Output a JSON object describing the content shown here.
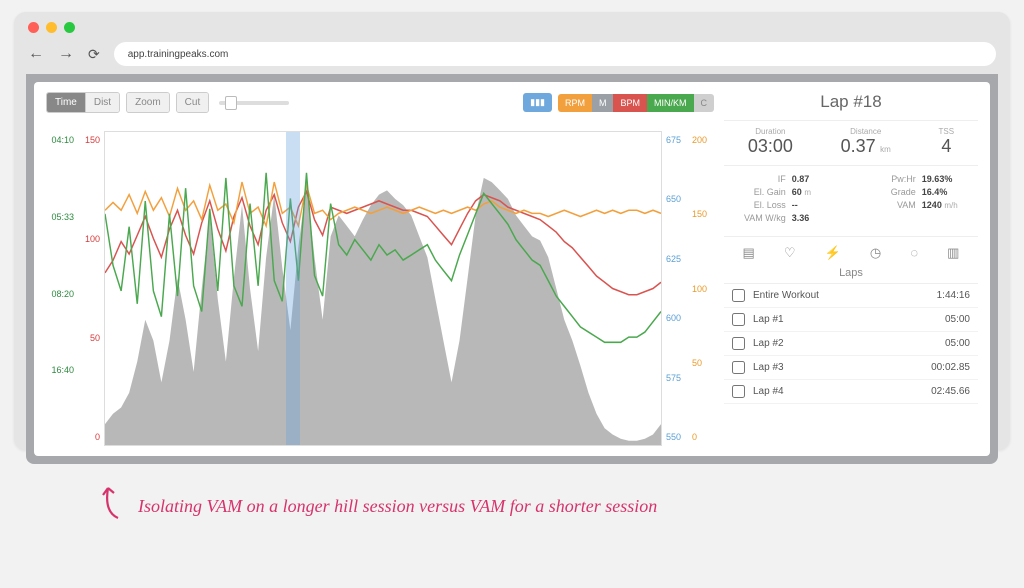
{
  "browser": {
    "url": "app.trainingpeaks.com"
  },
  "toolbar": {
    "time": "Time",
    "dist": "Dist",
    "zoom": "Zoom",
    "cut": "Cut"
  },
  "metrics": {
    "chart_icon": "▮▮▮",
    "rpm": {
      "label": "RPM",
      "color": "#f2a03d"
    },
    "m": {
      "label": "M",
      "color": "#9aa0a6"
    },
    "bpm": {
      "label": "BPM",
      "color": "#d9534f"
    },
    "minkm": {
      "label": "MIN/KM",
      "color": "#4aa84e"
    },
    "c": {
      "label": "C",
      "color": "#cfcfcf"
    }
  },
  "axes": {
    "left1": [
      "04:10",
      "05:33",
      "08:20",
      "16:40",
      ""
    ],
    "left2": [
      "150",
      "100",
      "50",
      "0"
    ],
    "right1": [
      "675",
      "650",
      "625",
      "600",
      "575",
      "550"
    ],
    "right2": [
      "200",
      "150",
      "100",
      "50",
      "0"
    ]
  },
  "chart_data": {
    "type": "line",
    "title": "",
    "xlabel": "",
    "ylabel": "",
    "selection_pct": [
      32.5,
      35.0
    ],
    "series": [
      {
        "name": "Elevation (M)",
        "color": "#a8a8a8",
        "unit": "m",
        "ylim": [
          550,
          700
        ],
        "values": [
          560,
          565,
          568,
          575,
          590,
          610,
          600,
          580,
          600,
          630,
          610,
          585,
          625,
          660,
          620,
          590,
          630,
          665,
          625,
          595,
          640,
          670,
          635,
          605,
          645,
          675,
          640,
          610,
          650,
          660,
          655,
          650,
          658,
          665,
          670,
          672,
          668,
          665,
          660,
          650,
          640,
          620,
          600,
          580,
          600,
          630,
          660,
          678,
          676,
          672,
          668,
          660,
          655,
          650,
          648,
          640,
          625,
          610,
          600,
          588,
          575,
          565,
          558,
          555,
          553,
          552,
          552,
          553,
          555,
          560
        ]
      },
      {
        "name": "BPM",
        "color": "#d9534f",
        "unit": "bpm",
        "ylim": [
          0,
          200
        ],
        "values": [
          110,
          118,
          130,
          122,
          134,
          146,
          132,
          120,
          138,
          150,
          134,
          122,
          142,
          156,
          138,
          124,
          146,
          158,
          140,
          128,
          150,
          160,
          142,
          130,
          152,
          162,
          144,
          134,
          152,
          150,
          148,
          150,
          152,
          154,
          156,
          154,
          152,
          150,
          150,
          148,
          146,
          140,
          134,
          128,
          138,
          148,
          156,
          160,
          158,
          156,
          152,
          150,
          148,
          146,
          144,
          140,
          136,
          130,
          126,
          120,
          114,
          108,
          104,
          100,
          98,
          96,
          96,
          98,
          100,
          104
        ]
      },
      {
        "name": "RPM",
        "color": "#f2a03d",
        "unit": "rpm",
        "ylim": [
          0,
          200
        ],
        "values": [
          150,
          155,
          150,
          160,
          148,
          162,
          150,
          158,
          146,
          164,
          150,
          156,
          144,
          166,
          150,
          154,
          142,
          168,
          148,
          152,
          140,
          168,
          148,
          152,
          140,
          166,
          148,
          150,
          144,
          148,
          150,
          152,
          150,
          148,
          150,
          152,
          150,
          148,
          150,
          152,
          150,
          148,
          150,
          148,
          150,
          152,
          150,
          154,
          156,
          152,
          150,
          148,
          150,
          148,
          148,
          146,
          148,
          150,
          148,
          146,
          148,
          150,
          148,
          150,
          148,
          150,
          150,
          148,
          150,
          148
        ]
      },
      {
        "name": "MIN/KM",
        "color": "#4aa84e",
        "unit": "min/km",
        "ylim_labels": [
          "04:10",
          "05:33",
          "08:20",
          "16:40"
        ],
        "values": [
          90,
          70,
          60,
          85,
          55,
          95,
          60,
          50,
          90,
          58,
          100,
          62,
          52,
          92,
          60,
          104,
          62,
          54,
          94,
          62,
          106,
          64,
          56,
          96,
          64,
          106,
          66,
          58,
          94,
          78,
          74,
          80,
          76,
          72,
          78,
          74,
          76,
          72,
          74,
          76,
          78,
          72,
          68,
          64,
          74,
          82,
          90,
          98,
          94,
          90,
          86,
          80,
          76,
          72,
          70,
          64,
          58,
          54,
          50,
          46,
          44,
          42,
          40,
          40,
          40,
          42,
          42,
          44,
          48,
          52
        ]
      }
    ]
  },
  "lap": {
    "title": "Lap #18",
    "duration": {
      "label": "Duration",
      "value": "03:00"
    },
    "distance": {
      "label": "Distance",
      "value": "0.37",
      "unit": "km"
    },
    "tss": {
      "label": "TSS",
      "value": "4"
    },
    "stats_left": [
      {
        "k": "IF",
        "v": "0.87",
        "u": ""
      },
      {
        "k": "El. Gain",
        "v": "60",
        "u": "m"
      },
      {
        "k": "El. Loss",
        "v": "--",
        "u": ""
      },
      {
        "k": "VAM W/kg",
        "v": "3.36",
        "u": ""
      }
    ],
    "stats_right": [
      {
        "k": "Pw:Hr",
        "v": "19.63%",
        "u": ""
      },
      {
        "k": "Grade",
        "v": "16.4%",
        "u": ""
      },
      {
        "k": "VAM",
        "v": "1240",
        "u": "m/h"
      }
    ]
  },
  "laps": {
    "header": "Laps",
    "rows": [
      {
        "name": "Entire Workout",
        "time": "1:44:16"
      },
      {
        "name": "Lap #1",
        "time": "05:00"
      },
      {
        "name": "Lap #2",
        "time": "05:00"
      },
      {
        "name": "Lap #3",
        "time": "00:02.85"
      },
      {
        "name": "Lap #4",
        "time": "02:45.66"
      }
    ]
  },
  "annotation": "Isolating VAM on a longer hill session versus VAM for a shorter session"
}
